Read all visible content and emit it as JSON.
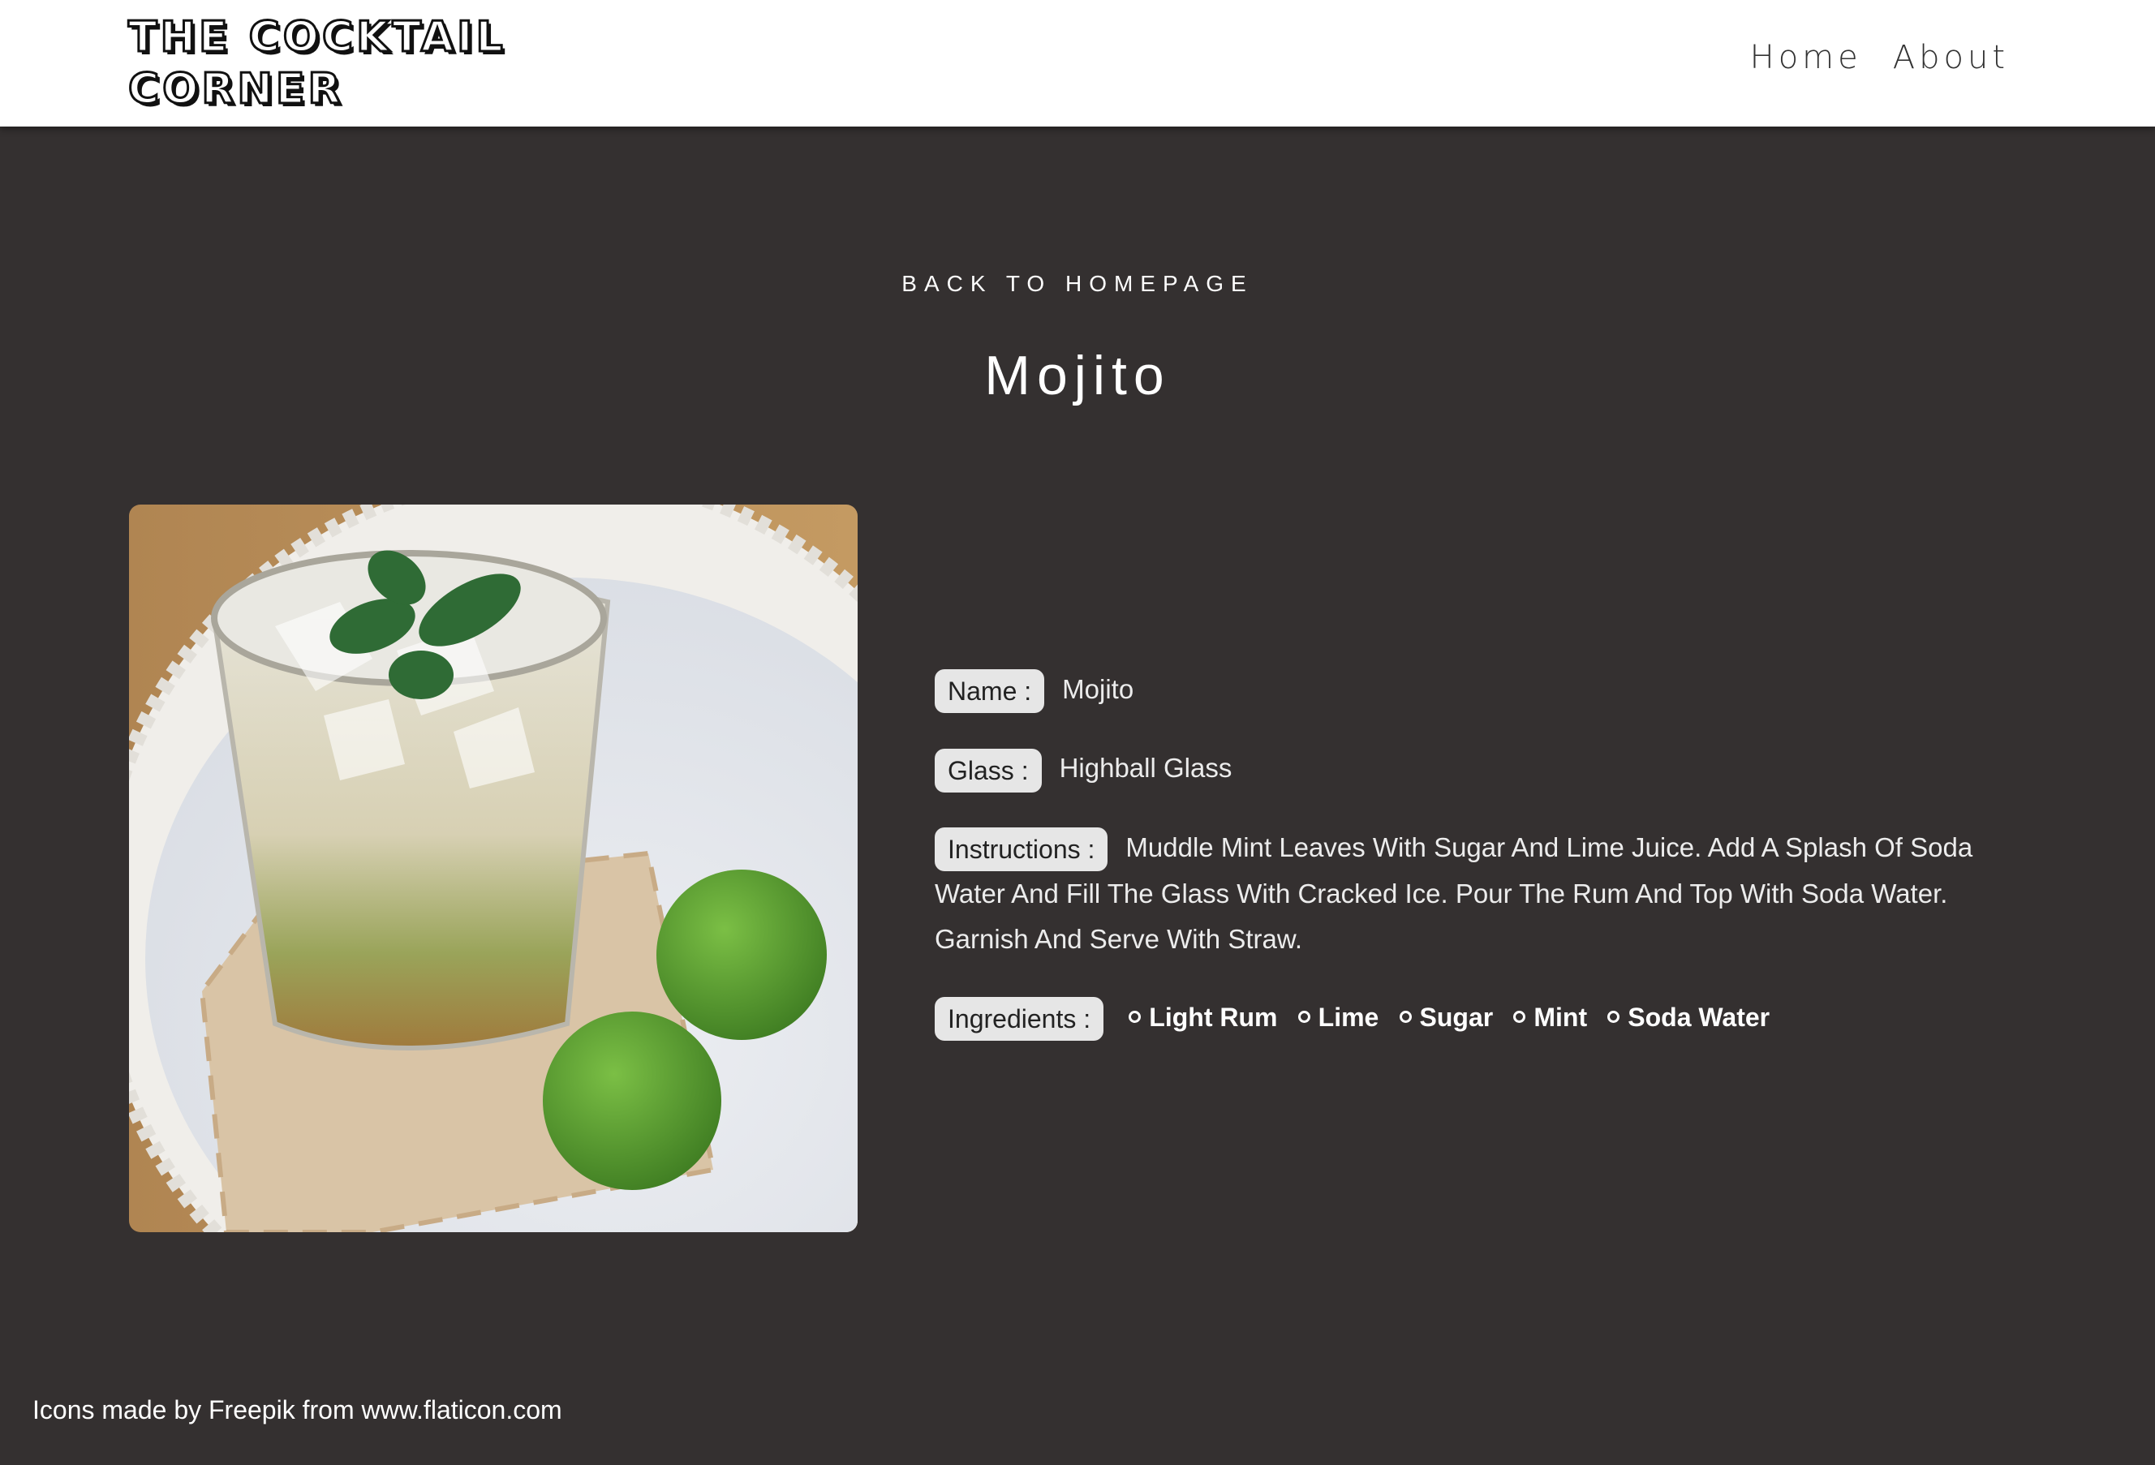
{
  "header": {
    "logo": "The Cocktail Corner",
    "nav": [
      {
        "label": "Home"
      },
      {
        "label": "About"
      }
    ]
  },
  "main": {
    "back_link": "Back to homepage",
    "title": "Mojito",
    "details": {
      "name_label": "Name :",
      "name_value": "Mojito",
      "glass_label": "Glass :",
      "glass_value": "Highball Glass",
      "instructions_label": "Instructions :",
      "instructions_value": "Muddle Mint Leaves With Sugar And Lime Juice. Add A Splash Of Soda Water And Fill The Glass With Cracked Ice. Pour The Rum And Top With Soda Water. Garnish And Serve With Straw.",
      "ingredients_label": "Ingredients :",
      "ingredients": [
        "Light Rum",
        "Lime",
        "Sugar",
        "Mint",
        "Soda Water"
      ]
    }
  },
  "footer": {
    "credit": "Icons made by Freepik from www.flaticon.com"
  },
  "colors": {
    "background": "#343030",
    "header_bg": "#ffffff",
    "pill_bg": "#e6e6e6",
    "text_light": "#ffffff"
  }
}
